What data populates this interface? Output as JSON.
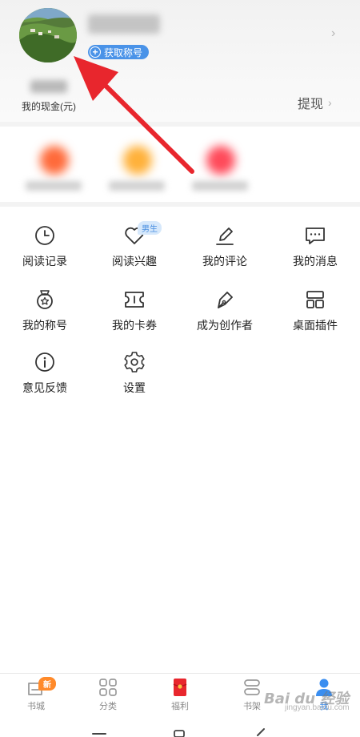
{
  "header": {
    "title_badge": "获取称号",
    "cash_label": "我的现金(元)",
    "withdraw_label": "提现"
  },
  "menu": [
    {
      "label": "阅读记录",
      "icon": "clock-icon"
    },
    {
      "label": "阅读兴趣",
      "icon": "heart-icon",
      "tag": "男生"
    },
    {
      "label": "我的评论",
      "icon": "pencil-icon"
    },
    {
      "label": "我的消息",
      "icon": "message-icon"
    },
    {
      "label": "我的称号",
      "icon": "medal-icon"
    },
    {
      "label": "我的卡券",
      "icon": "ticket-icon"
    },
    {
      "label": "成为创作者",
      "icon": "pen-nib-icon"
    },
    {
      "label": "桌面插件",
      "icon": "widget-icon"
    },
    {
      "label": "意见反馈",
      "icon": "info-icon"
    },
    {
      "label": "设置",
      "icon": "gear-icon"
    }
  ],
  "tabbar": [
    {
      "label": "书城",
      "badge": "新"
    },
    {
      "label": "分类"
    },
    {
      "label": "福利"
    },
    {
      "label": "书架"
    },
    {
      "label": "我"
    }
  ],
  "colors": {
    "accent": "#3a8ef0",
    "badge": "#4a93e8",
    "new_badge": "#ff8a2a",
    "arrow": "#e8262d"
  },
  "watermark": {
    "logo": "Bai du 经验",
    "url": "jingyan.baidu.com"
  }
}
